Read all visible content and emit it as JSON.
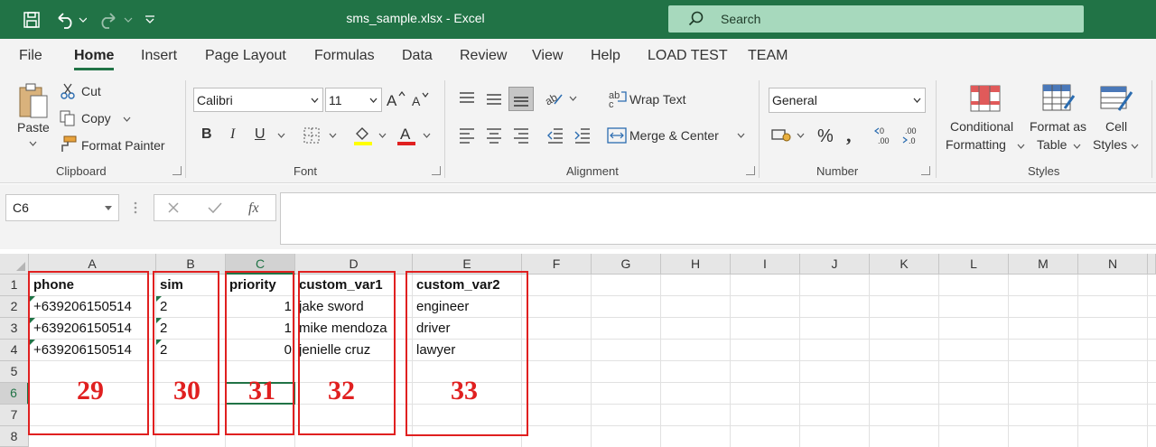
{
  "window": {
    "title": "sms_sample.xlsx  -  Excel",
    "search_placeholder": "Search"
  },
  "quick_access": {
    "icons": [
      "save-icon",
      "undo-icon",
      "redo-icon",
      "customize-icon"
    ]
  },
  "menu": {
    "tabs": [
      "File",
      "Home",
      "Insert",
      "Page Layout",
      "Formulas",
      "Data",
      "Review",
      "View",
      "Help",
      "LOAD TEST",
      "TEAM"
    ],
    "active": "Home"
  },
  "ribbon": {
    "clipboard": {
      "label": "Clipboard",
      "paste": "Paste",
      "cut": "Cut",
      "copy": "Copy",
      "format_painter": "Format Painter"
    },
    "font": {
      "label": "Font",
      "font_name": "Calibri",
      "font_size": "11",
      "bold": "B",
      "italic": "I",
      "underline": "U"
    },
    "alignment": {
      "label": "Alignment",
      "wrap_text": "Wrap Text",
      "merge_center": "Merge & Center"
    },
    "number": {
      "label": "Number",
      "format": "General"
    },
    "styles": {
      "label": "Styles",
      "conditional_formatting": [
        "Conditional",
        "Formatting"
      ],
      "format_as_table": [
        "Format as",
        "Table"
      ],
      "cell_styles": [
        "Cell",
        "Styles"
      ]
    }
  },
  "formula_bar": {
    "name_box": "C6",
    "formula": ""
  },
  "sheet": {
    "columns": [
      "A",
      "B",
      "C",
      "D",
      "E",
      "F",
      "G",
      "H",
      "I",
      "J",
      "K",
      "L",
      "M",
      "N"
    ],
    "rows": [
      "1",
      "2",
      "3",
      "4",
      "5",
      "6",
      "7",
      "8"
    ],
    "selected_cell": "C6",
    "cells": {
      "A1": "phone",
      "B1": "sim",
      "C1": "priority",
      "D1": "custom_var1",
      "E1": "custom_var2",
      "A2": "+639206150514",
      "B2": "2",
      "C2": "1",
      "D2": "jake sword",
      "E2": "engineer",
      "A3": "+639206150514",
      "B3": "2",
      "C3": "1",
      "D3": "mike mendoza",
      "E3": "driver",
      "A4": "+639206150514",
      "B4": "2",
      "C4": "0",
      "D4": "jenielle cruz",
      "E4": "lawyer"
    }
  },
  "annotations": {
    "labels": [
      "29",
      "30",
      "31",
      "32",
      "33"
    ],
    "color": "#e02020"
  },
  "colors": {
    "brand": "#217346",
    "search_bg": "#a7d9bd",
    "annotation": "#e02020"
  }
}
